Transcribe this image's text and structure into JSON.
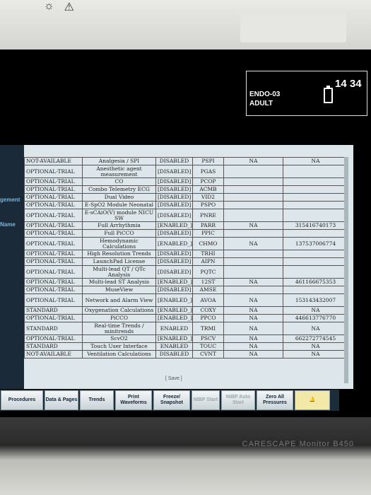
{
  "header": {
    "patient_name": "ENDO-03",
    "patient_category": "ADULT",
    "time": "14 34"
  },
  "left_menu": [
    "gement",
    "Name"
  ],
  "license_table": {
    "rows": [
      [
        "NOT-AVAILABLE",
        "Analgesia / SPI",
        "DISABLED",
        "PSPI",
        "NA",
        "NA"
      ],
      [
        "OPTIONAL-TRIAL",
        "Anesthetic agent measurement",
        "[DISABLED]",
        "PGAS",
        "",
        ""
      ],
      [
        "OPTIONAL-TRIAL",
        "CO",
        "[DISABLED]",
        "PCOP",
        "",
        ""
      ],
      [
        "OPTIONAL-TRIAL",
        "Combo Telemetry ECG",
        "[DISABLED]",
        "ACMB",
        "",
        ""
      ],
      [
        "OPTIONAL-TRIAL",
        "Dual Video",
        "[DISABLED]",
        "VID2",
        "",
        ""
      ],
      [
        "OPTIONAL-TRIAL",
        "E-SpO2 Module Neonatal",
        "[DISABLED]",
        "PSPO",
        "",
        ""
      ],
      [
        "OPTIONAL-TRIAL",
        "E-sCAiO(V) module NICU SW",
        "[DISABLED]",
        "PNRE",
        "",
        ""
      ],
      [
        "OPTIONAL-TRIAL",
        "Full Arrhythmia",
        "[ENABLED_]",
        "PARR",
        "NA",
        "315416740173"
      ],
      [
        "OPTIONAL-TRIAL",
        "Full PiCCO",
        "[DISABLED]",
        "PPIC",
        "",
        ""
      ],
      [
        "OPTIONAL-TRIAL",
        "Hemodynamic Calculations",
        "[ENABLED_]",
        "CHMO",
        "NA",
        "137537006774"
      ],
      [
        "OPTIONAL-TRIAL",
        "High Resolution Trends",
        "[DISABLED]",
        "TRHI",
        "",
        ""
      ],
      [
        "OPTIONAL-TRIAL",
        "LaunchPad License",
        "[DISABLED]",
        "AIPN",
        "",
        ""
      ],
      [
        "OPTIONAL-TRIAL",
        "Multi-lead QT / QTc Analysis",
        "[DISABLED]",
        "PQTC",
        "",
        ""
      ],
      [
        "OPTIONAL-TRIAL",
        "Multi-lead ST Analysis",
        "[ENABLED_]",
        "12ST",
        "NA",
        "461166675353"
      ],
      [
        "OPTIONAL-TRIAL",
        "MuseView",
        "[DISABLED]",
        "AMSE",
        "",
        ""
      ],
      [
        "OPTIONAL-TRIAL",
        "Network and Alarm View",
        "[ENABLED_]",
        "AVOA",
        "NA",
        "153143432007"
      ],
      [
        "STANDARD",
        "Oxygenation Calculations",
        "[ENABLED_]",
        "COXY",
        "NA",
        "NA"
      ],
      [
        "OPTIONAL-TRIAL",
        "PiCCO",
        "[ENABLED_]",
        "PPCO",
        "NA",
        "446613776770"
      ],
      [
        "STANDARD",
        "Real-time Trends / minitrends",
        "ENABLED",
        "TRMI",
        "NA",
        "NA"
      ],
      [
        "OPTIONAL-TRIAL",
        "ScvO2",
        "[ENABLED_]",
        "PSCV",
        "NA",
        "662272774545"
      ],
      [
        "STANDARD",
        "Touch User Interface",
        "ENABLED",
        "TOUC",
        "NA",
        "NA"
      ],
      [
        "NOT-AVAILABLE",
        "Ventilation Calculations",
        "DISABLED",
        "CVNT",
        "NA",
        "NA"
      ]
    ],
    "save_label": "[ Save ]"
  },
  "toolbar": {
    "procedures": "Procedures",
    "data_pages": "Data & Pages",
    "trends": "Trends",
    "print_waveforms": "Print Waveforms",
    "freeze_snapshot": "Freeze/ Snapshot",
    "nibp_start": "NIBP Start",
    "nibp_auto": "NIBP Auto Start",
    "zero_all": "Zero All Pressures",
    "alarm_icon": "alarm-bell-icon"
  },
  "brand": "CARESCAPE Monitor B450"
}
